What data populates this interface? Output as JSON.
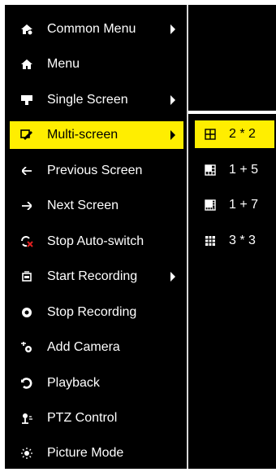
{
  "menu": {
    "items": [
      {
        "label": "Common Menu",
        "icon": "common-menu-icon"
      },
      {
        "label": "Menu",
        "icon": "home-icon"
      },
      {
        "label": "Single Screen",
        "icon": "single-screen-icon"
      },
      {
        "label": "Multi-screen",
        "icon": "multi-screen-icon"
      },
      {
        "label": "Previous Screen",
        "icon": "arrow-left-icon"
      },
      {
        "label": "Next Screen",
        "icon": "arrow-right-icon"
      },
      {
        "label": "Stop Auto-switch",
        "icon": "stop-auto-switch-icon"
      },
      {
        "label": "Start Recording",
        "icon": "start-recording-icon"
      },
      {
        "label": "Stop Recording",
        "icon": "stop-recording-icon"
      },
      {
        "label": "Add Camera",
        "icon": "add-camera-icon"
      },
      {
        "label": "Playback",
        "icon": "playback-icon"
      },
      {
        "label": "PTZ Control",
        "icon": "ptz-control-icon"
      },
      {
        "label": "Picture Mode",
        "icon": "picture-mode-icon"
      }
    ]
  },
  "submenu": {
    "items": [
      {
        "label": "2 * 2",
        "icon": "grid-2x2-icon"
      },
      {
        "label": "1 + 5",
        "icon": "layout-1plus5-icon"
      },
      {
        "label": "1 + 7",
        "icon": "layout-1plus7-icon"
      },
      {
        "label": "3 * 3",
        "icon": "grid-3x3-icon"
      }
    ]
  },
  "colors": {
    "highlight": "#ffee00",
    "background": "#000000",
    "text": "#ffffff"
  }
}
